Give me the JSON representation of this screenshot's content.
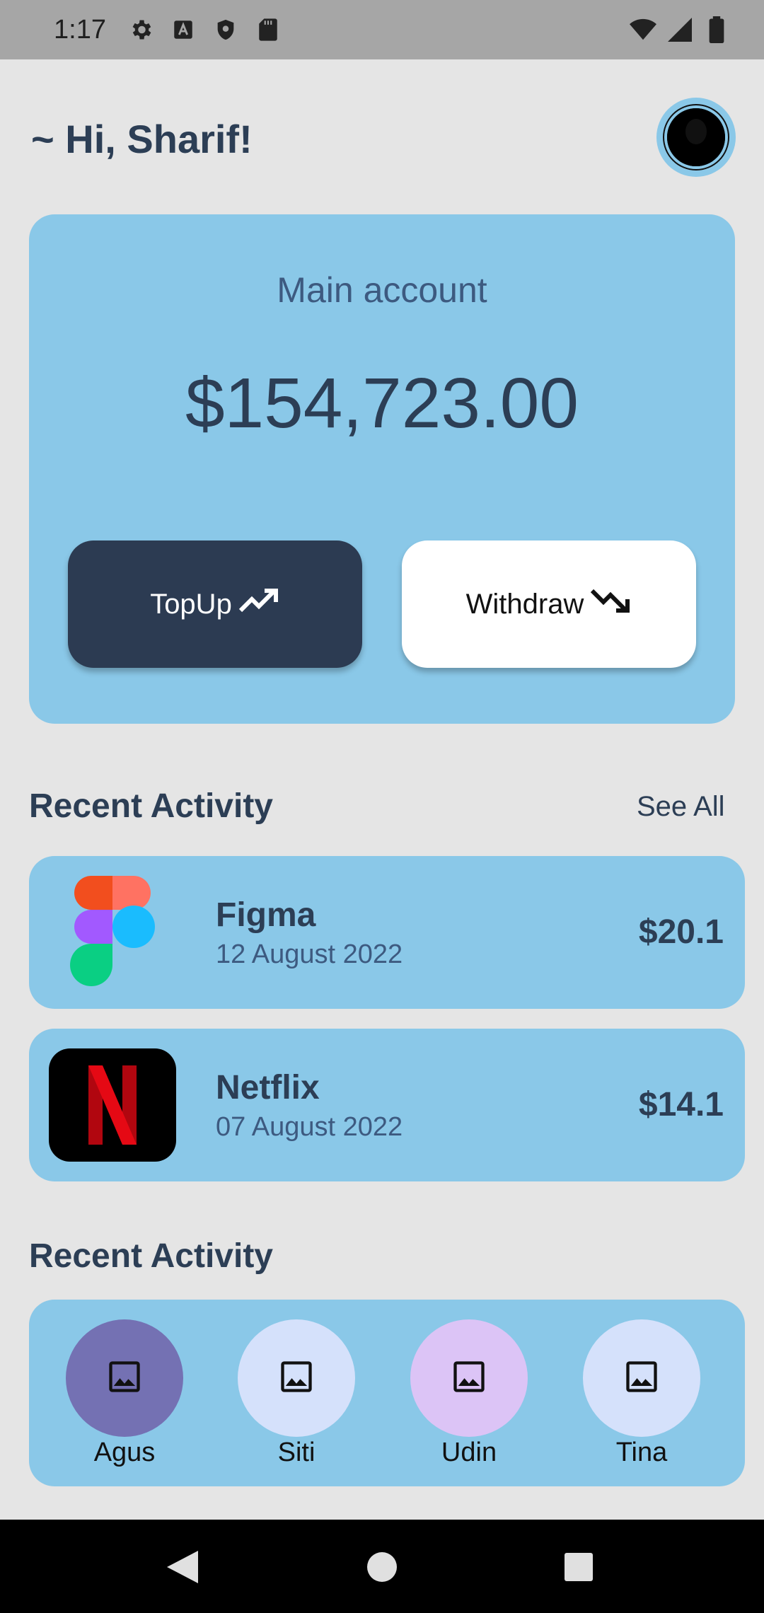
{
  "status_bar": {
    "time": "1:17",
    "left_icons": [
      "gear-icon",
      "text-a-icon",
      "shield-icon",
      "sd-card-icon"
    ],
    "right_icons": [
      "wifi-icon",
      "signal-icon",
      "battery-icon"
    ]
  },
  "header": {
    "greeting": "~ Hi, Sharif!",
    "avatar_icon": "user-avatar-icon"
  },
  "account": {
    "label": "Main account",
    "balance": "$154,723.00",
    "topup_label": "TopUp",
    "withdraw_label": "Withdraw"
  },
  "recent_activity": {
    "title": "Recent Activity",
    "see_all": "See All",
    "items": [
      {
        "name": "Figma",
        "date": "12 August 2022",
        "amount": "$20.1",
        "icon": "figma-logo-icon"
      },
      {
        "name": "Netflix",
        "date": "07 August 2022",
        "amount": "$14.1",
        "icon": "netflix-logo-icon"
      }
    ]
  },
  "contacts": {
    "title": "Recent Activity",
    "items": [
      {
        "name": "Agus",
        "color": "#7471b3"
      },
      {
        "name": "Siti",
        "color": "#d5e1fb"
      },
      {
        "name": "Udin",
        "color": "#dcc4f6"
      },
      {
        "name": "Tina",
        "color": "#d5e1fb"
      }
    ]
  },
  "colors": {
    "background": "#e5e5e5",
    "card": "#8ac8e8",
    "primary_dark": "#2c3b52",
    "text": "#2c3e55"
  }
}
